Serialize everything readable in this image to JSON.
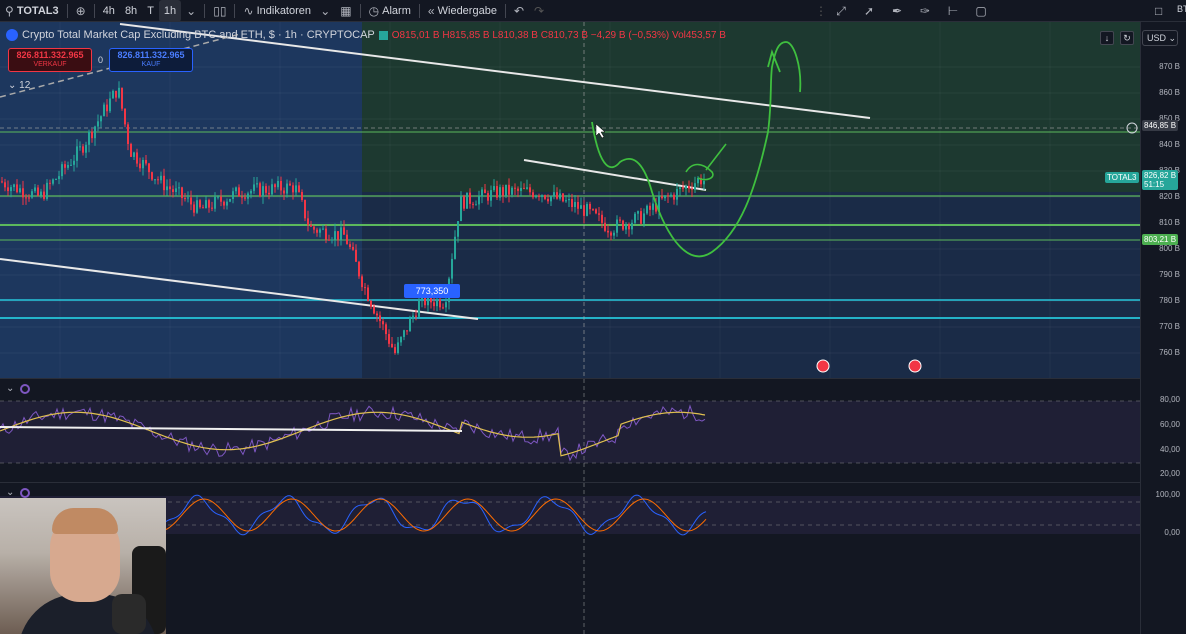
{
  "toolbar": {
    "symbol": "TOTAL3",
    "intervals": [
      "4h",
      "8h",
      "T",
      "1h"
    ],
    "active_interval": "1h",
    "indicators_label": "Indikatoren",
    "alarm_label": "Alarm",
    "replay_label": "Wiedergabe"
  },
  "legend": {
    "title": "Crypto Total Market Cap Excluding BTC and ETH, $ · 1h · CRYPTOCAP",
    "ohlc": "O815,01 B  H815,85 B  L810,38 B  C810,73 B  −4,29 B (−0,53%)  Vol453,57 B",
    "sell_price": "826.811.332.965",
    "sell_label": "VERKAUF",
    "spread": "0",
    "buy_price": "826.811.332.965",
    "buy_label": "KAUF",
    "collapsed_count": "12",
    "box_label": "773,350"
  },
  "price_axis": {
    "currency": "USD",
    "ticks": [
      "870 B",
      "860 B",
      "850 B",
      "840 B",
      "830 B",
      "820 B",
      "810 B",
      "800 B",
      "790 B",
      "780 B",
      "770 B",
      "760 B"
    ],
    "crosshair_label": "846,85 B",
    "symbol_badge": "TOTAL3",
    "current_price": "826,82 B",
    "countdown": "51:15",
    "green_badge": "803,21 B",
    "rsi_ticks": [
      "80,00",
      "60,00",
      "40,00",
      "20,00"
    ],
    "stoch_ticks": [
      "100,00",
      "0,00"
    ],
    "corner": "BT"
  },
  "colors": {
    "up": "#26a69a",
    "down": "#f23645",
    "zone_left": "#1e3a63",
    "zone_right": "#1d3b2f",
    "hline_green": "#5cb85c",
    "hline_teal": "#26c6da",
    "rsi": "#7e57c2",
    "rsi_ma": "#e0c050",
    "drawing": "#3fbf3f"
  },
  "icons": [
    "search-icon",
    "plus-circle-icon",
    "chevron-down-icon",
    "candles-icon",
    "indicators-icon",
    "grid-icon",
    "alarm-icon",
    "replay-icon",
    "undo-icon",
    "redo-icon",
    "line-tool-icon",
    "pen-icon",
    "brush-icon",
    "crosshair-tool-icon",
    "square-icon"
  ]
}
